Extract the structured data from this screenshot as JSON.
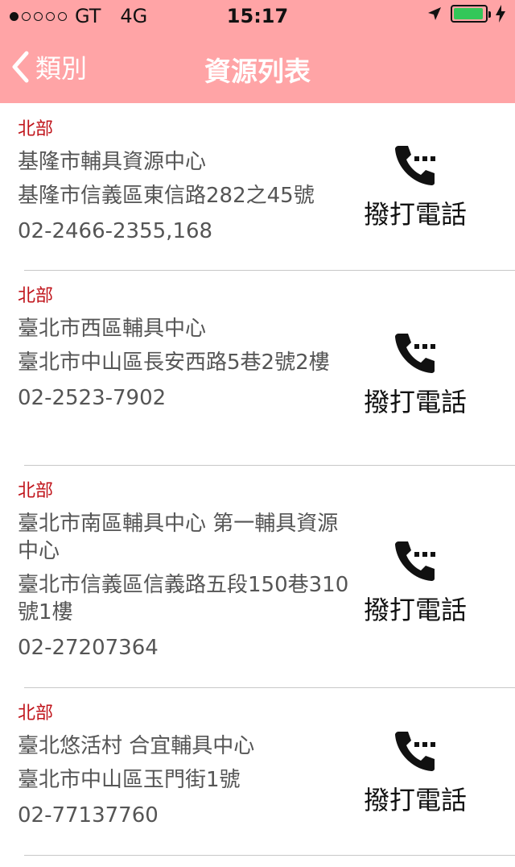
{
  "status_bar": {
    "carrier": "GT",
    "network": "4G",
    "time": "15:17"
  },
  "nav": {
    "back_label": "類別",
    "title": "資源列表"
  },
  "call_label": "撥打電話",
  "items": [
    {
      "region": "北部",
      "name": "基隆市輔具資源中心",
      "address": "基隆市信義區東信路282之45號",
      "phone": "02-2466-2355,168"
    },
    {
      "region": "北部",
      "name": "臺北市西區輔具中心",
      "address": "臺北市中山區長安西路5巷2號2樓",
      "phone": "02-2523-7902"
    },
    {
      "region": "北部",
      "name": "臺北市南區輔具中心 第一輔具資源中心",
      "address": "臺北市信義區信義路五段150巷310號1樓",
      "phone": "02-27207364"
    },
    {
      "region": "北部",
      "name": "臺北悠活村 合宜輔具中心",
      "address": "臺北市中山區玉門街1號",
      "phone": "02-77137760"
    }
  ]
}
